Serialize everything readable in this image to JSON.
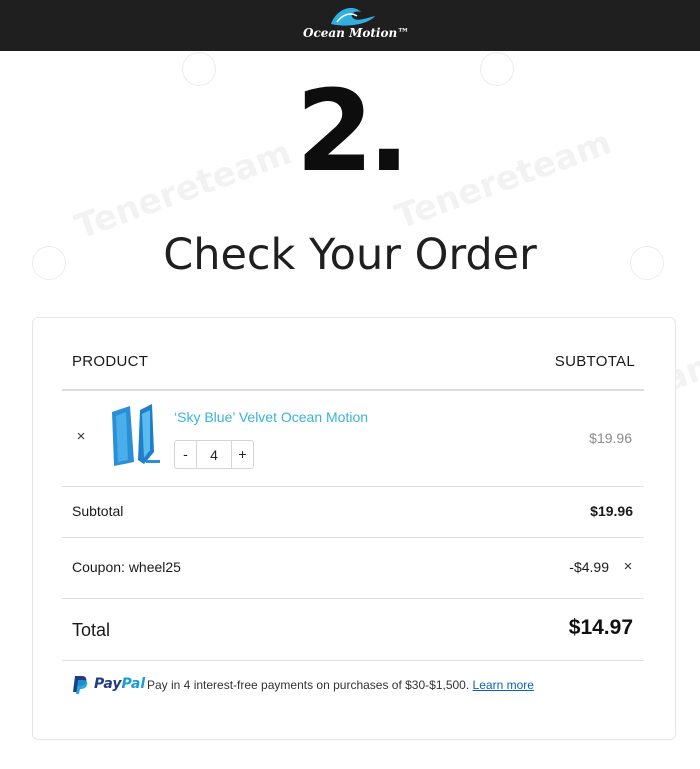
{
  "header": {
    "logo_text": "Ocean Motion™",
    "logo_icon": "wave-icon"
  },
  "step": {
    "number": "2.",
    "title": "Check Your Order"
  },
  "order_table": {
    "col_product": "PRODUCT",
    "col_subtotal": "SUBTOTAL",
    "items": [
      {
        "name": "‘Sky Blue’ Velvet Ocean Motion",
        "quantity": "4",
        "qty_minus": "-",
        "qty_plus": "+",
        "price": "$19.96",
        "remove_icon": "×"
      }
    ]
  },
  "summary": {
    "subtotal_label": "Subtotal",
    "subtotal_value": "$19.96",
    "coupon_label": "Coupon: wheel25",
    "coupon_value": "-$4.99",
    "coupon_remove_icon": "×",
    "total_label": "Total",
    "total_value": "$14.97"
  },
  "paypal": {
    "brand_pay": "Pay",
    "brand_pal": "Pal",
    "message": "Pay in 4 interest-free payments on purchases of $30-$1,500.",
    "link_text": "Learn more"
  },
  "colors": {
    "topbar": "#1f1f1f",
    "product_link": "#38b3da",
    "paypal_dark": "#253b80",
    "paypal_light": "#179bd7",
    "link": "#0a63b8"
  }
}
